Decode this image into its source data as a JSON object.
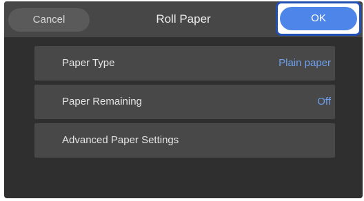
{
  "header": {
    "title": "Roll Paper",
    "cancel_label": "Cancel",
    "ok_label": "OK"
  },
  "menu": {
    "items": [
      {
        "label": "Paper Type",
        "value": "Plain paper"
      },
      {
        "label": "Paper Remaining",
        "value": "Off"
      },
      {
        "label": "Advanced Paper Settings"
      }
    ]
  },
  "colors": {
    "background": "#2f2f2f",
    "title_bar": "#474747",
    "item_background": "#484848",
    "accent": "#4d86e8",
    "value_text": "#6d9fef",
    "highlight_border": "#1f4fb3"
  }
}
